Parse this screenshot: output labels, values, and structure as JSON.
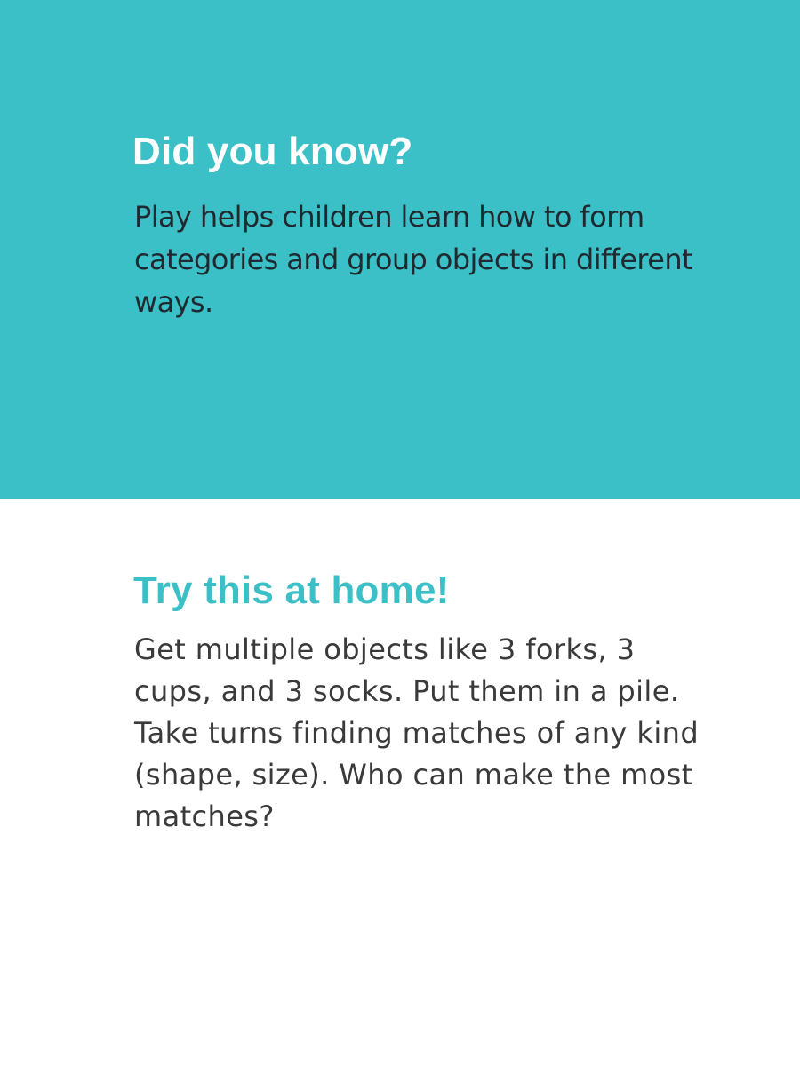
{
  "did_you_know": {
    "heading": "Did you know?",
    "text": "Play helps children learn how to form categories and group objects in different ways."
  },
  "try_at_home": {
    "heading": "Try this at home!",
    "text": "Get multiple objects like 3 forks, 3 cups, and 3 socks. Put them in a pile. Take turns finding matches of any kind (shape, size). Who can make the most matches?"
  },
  "colors": {
    "accent": "#3cc0c8",
    "background": "#ffffff",
    "heading_on_accent": "#ffffff",
    "body_text_dark": "#1f2a30",
    "body_text": "#3a3a3a"
  }
}
